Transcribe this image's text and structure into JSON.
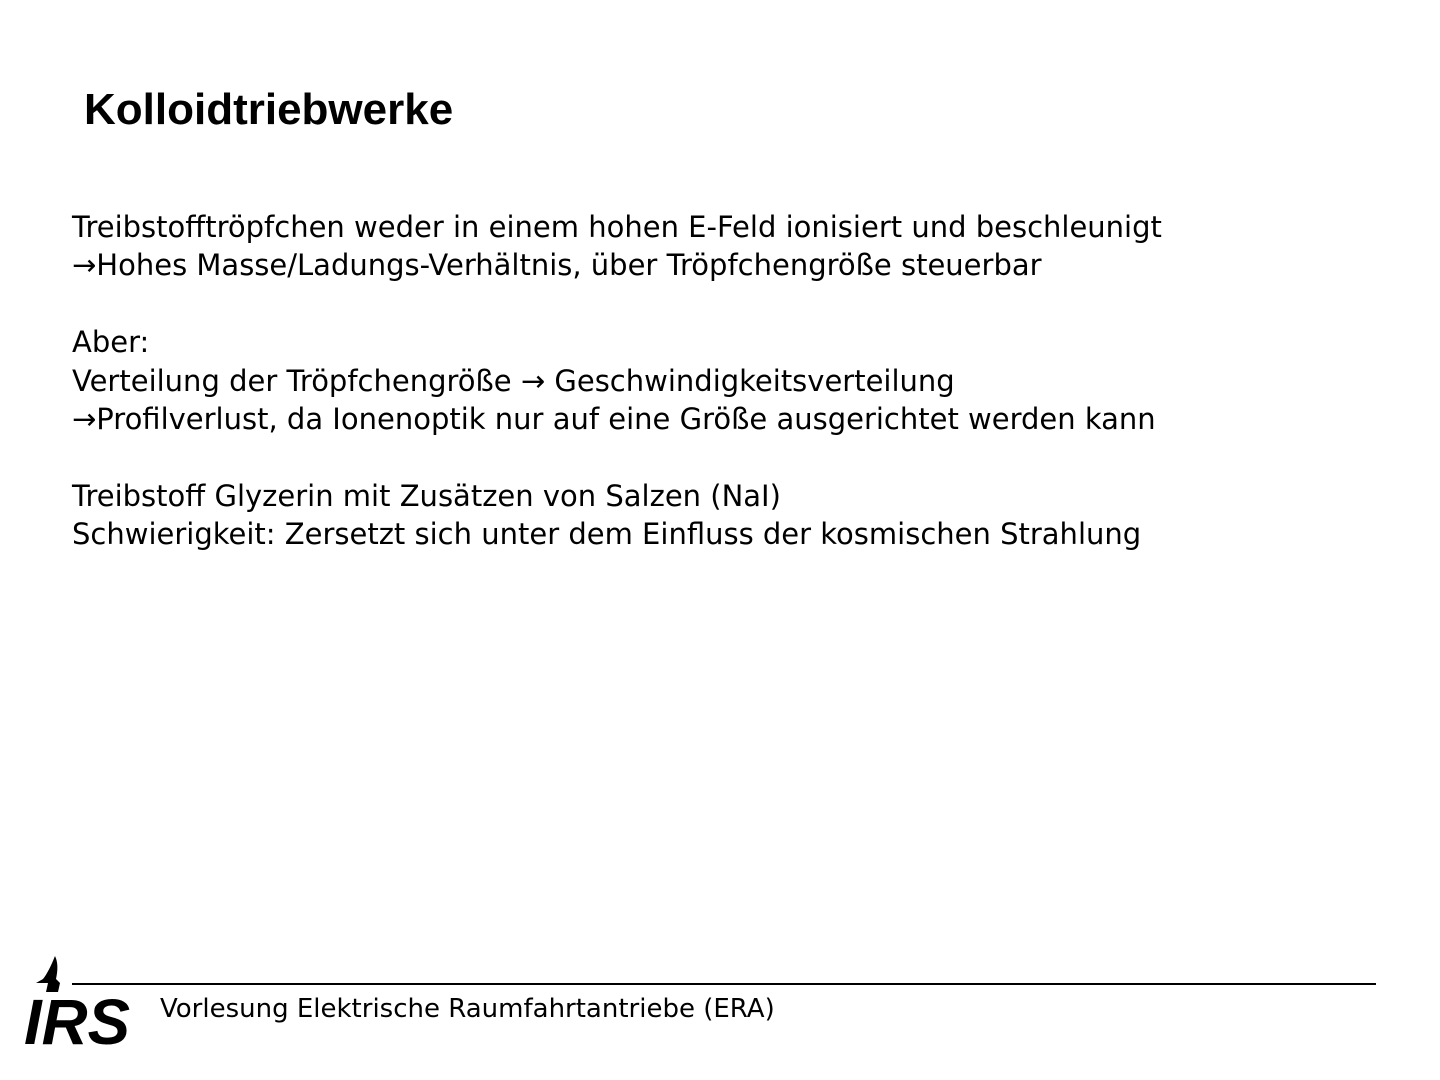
{
  "slide": {
    "title": "Kolloidtriebwerke",
    "body": {
      "line1": "Treibstofftröpfchen weder in einem hohen E-Feld ionisiert und beschleunigt",
      "line2": "→Hohes Masse/Ladungs-Verhältnis, über Tröpfchengröße steuerbar",
      "line3": "Aber:",
      "line4": "Verteilung der Tröpfchengröße → Geschwindigkeitsverteilung",
      "line5": "→Profilverlust, da Ionenoptik nur auf eine Größe ausgerichtet werden kann",
      "line6": "Treibstoff Glyzerin mit Zusätzen von Salzen (NaI)",
      "line7": "Schwierigkeit: Zersetzt sich unter dem Einfluss der kosmischen Strahlung"
    }
  },
  "footer": {
    "lecture": "Vorlesung Elektrische Raumfahrtantriebe (ERA)",
    "logo_text": "IRS",
    "logo_icon": "rocket-icon"
  },
  "colors": {
    "text": "#000000",
    "background": "#ffffff"
  }
}
